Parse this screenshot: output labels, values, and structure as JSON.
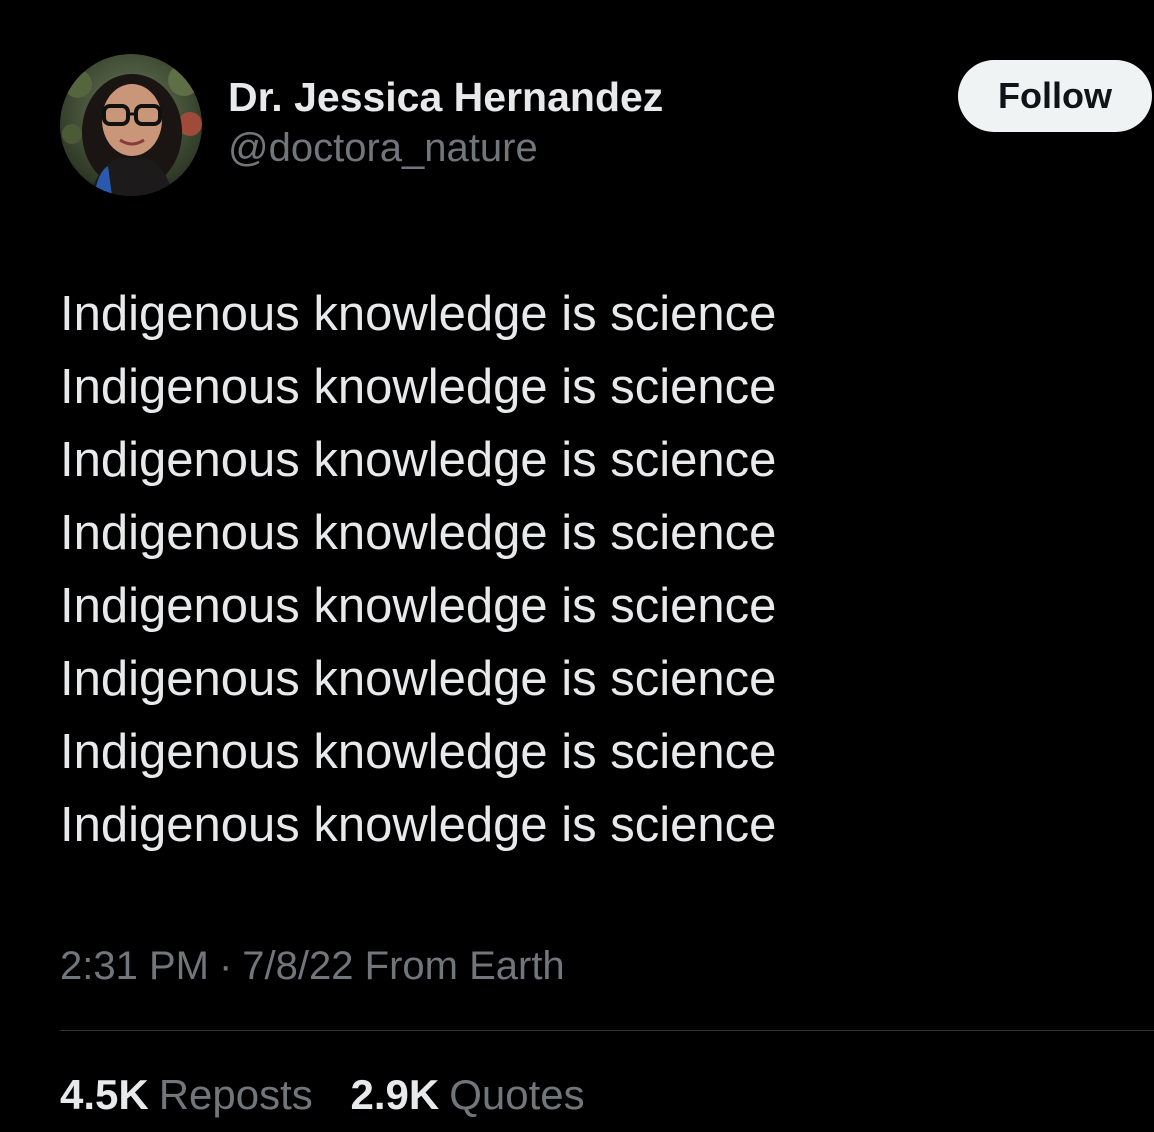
{
  "user": {
    "display_name": "Dr. Jessica Hernandez",
    "handle": "@doctora_nature",
    "avatar_icon": "profile-photo"
  },
  "follow_button": {
    "label": "Follow"
  },
  "tweet": {
    "lines": [
      "Indigenous knowledge is science",
      "Indigenous knowledge is science",
      "Indigenous knowledge is science",
      "Indigenous knowledge is science",
      "Indigenous knowledge is science",
      "Indigenous knowledge is science",
      "Indigenous knowledge is science",
      "Indigenous knowledge is science"
    ]
  },
  "meta": {
    "time": "2:31 PM",
    "separator": "·",
    "date": "7/8/22",
    "location": "From Earth"
  },
  "stats": {
    "reposts_count": "4.5K",
    "reposts_label": "Reposts",
    "quotes_count": "2.9K",
    "quotes_label": "Quotes"
  },
  "colors": {
    "background": "#000000",
    "primary_text": "#e7e9ea",
    "secondary_text": "#71767b",
    "follow_bg": "#eff3f4",
    "follow_text": "#0f1419",
    "divider": "#2f3336"
  }
}
